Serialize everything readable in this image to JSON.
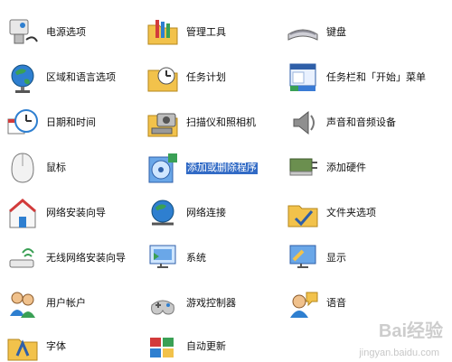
{
  "panel": {
    "items": [
      {
        "label": "电源选项",
        "icon": "power-options-icon"
      },
      {
        "label": "管理工具",
        "icon": "admin-tools-icon"
      },
      {
        "label": "键盘",
        "icon": "keyboard-icon"
      },
      {
        "label": "区域和语言选项",
        "icon": "globe-icon"
      },
      {
        "label": "任务计划",
        "icon": "scheduled-tasks-icon"
      },
      {
        "label": "任务栏和「开始」菜单",
        "icon": "taskbar-icon"
      },
      {
        "label": "日期和时间",
        "icon": "datetime-icon"
      },
      {
        "label": "扫描仪和照相机",
        "icon": "scanner-camera-icon"
      },
      {
        "label": "声音和音频设备",
        "icon": "speaker-icon"
      },
      {
        "label": "鼠标",
        "icon": "mouse-icon"
      },
      {
        "label": "添加或删除程序",
        "icon": "add-remove-programs-icon"
      },
      {
        "label": "添加硬件",
        "icon": "add-hardware-icon"
      },
      {
        "label": "网络安装向导",
        "icon": "network-setup-icon"
      },
      {
        "label": "网络连接",
        "icon": "network-connections-icon"
      },
      {
        "label": "文件夹选项",
        "icon": "folder-options-icon"
      },
      {
        "label": "无线网络安装向导",
        "icon": "wireless-setup-icon"
      },
      {
        "label": "系统",
        "icon": "system-icon"
      },
      {
        "label": "显示",
        "icon": "display-icon"
      },
      {
        "label": "用户帐户",
        "icon": "user-accounts-icon"
      },
      {
        "label": "游戏控制器",
        "icon": "game-controller-icon"
      },
      {
        "label": "语音",
        "icon": "speech-icon"
      },
      {
        "label": "字体",
        "icon": "fonts-icon"
      },
      {
        "label": "自动更新",
        "icon": "auto-update-icon"
      }
    ]
  },
  "watermark": {
    "main": "Bai经验",
    "sub": "jingyan.baidu.com"
  },
  "colors": {
    "selection": "#316ac5",
    "folder": "#f2c24b",
    "globe": "#2e7fd0"
  }
}
